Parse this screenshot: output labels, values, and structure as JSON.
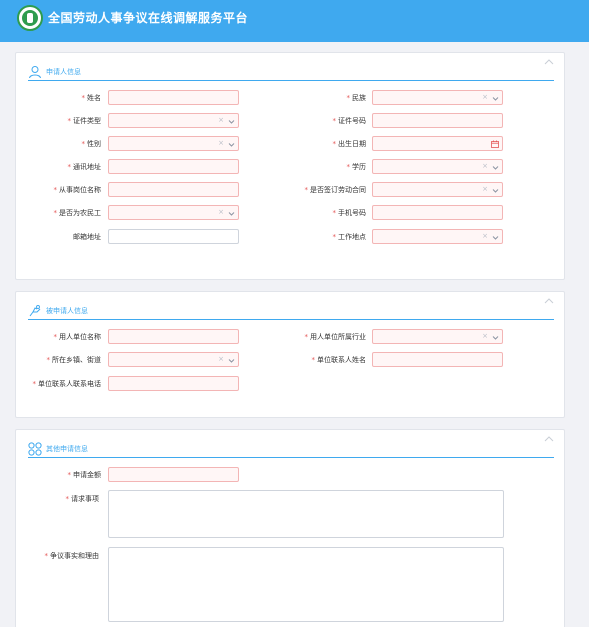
{
  "app": {
    "title": "全国劳动人事争议在线调解服务平台"
  },
  "sections": {
    "applicant": {
      "title": "申请人信息",
      "fields": {
        "name": "姓名",
        "ethnicity": "民族",
        "id_type": "证件类型",
        "id_number": "证件号码",
        "gender": "性别",
        "birth_date": "出生日期",
        "address": "通讯地址",
        "education": "学历",
        "position": "从事岗位名称",
        "labor_contract": "是否签订劳动合同",
        "migrant_worker": "是否为农民工",
        "phone": "手机号码",
        "email": "邮箱地址",
        "work_location": "工作地点"
      }
    },
    "respondent": {
      "title": "被申请人信息",
      "fields": {
        "employer_name": "用人单位名称",
        "employer_industry": "用人单位所属行业",
        "town_street": "所在乡镇、街道",
        "contact_name": "单位联系人姓名",
        "contact_phone": "单位联系人联系电话"
      }
    },
    "other": {
      "title": "其他申请信息",
      "fields": {
        "amount": "申请金额",
        "claims": "请求事项",
        "facts": "争议事实和理由"
      }
    }
  },
  "symbols": {
    "clear": "×",
    "required": "*"
  },
  "colors": {
    "header": "#3fa9ef",
    "accent": "#3fa9ef",
    "required": "#e45656",
    "field_error_border": "#f3b5b5",
    "field_error_bg": "#fff6f6"
  },
  "icons": {
    "section_applicant": "user-icon",
    "section_respondent": "hand-icon",
    "section_other": "grid-icon",
    "select": "chevron-down-icon",
    "date": "calendar-icon",
    "clear": "clear-icon",
    "collapse": "chevron-up-icon"
  }
}
